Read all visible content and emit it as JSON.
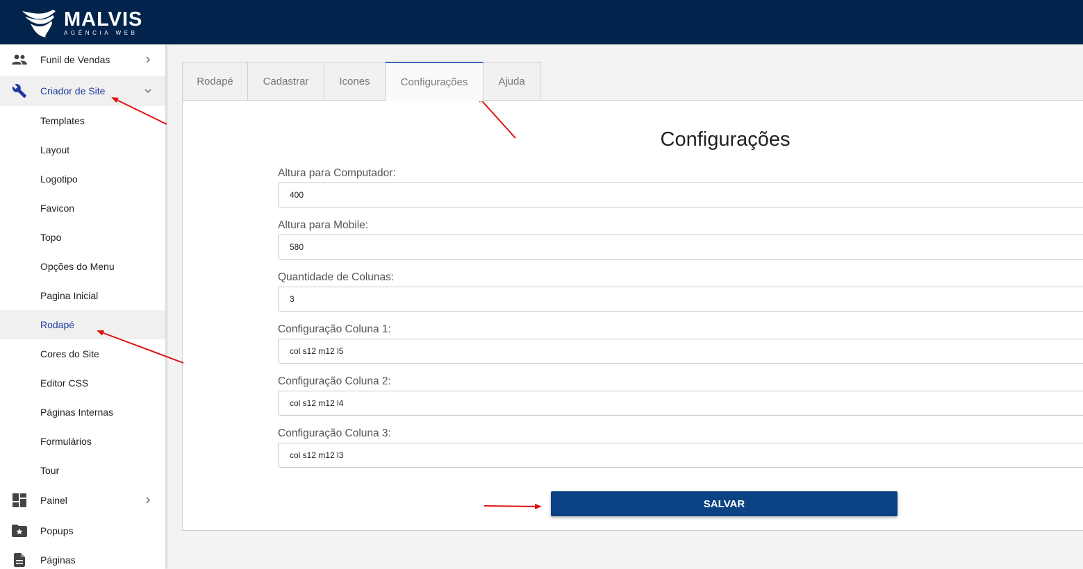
{
  "header": {
    "logo_text": "MALVIS",
    "logo_subtext": "AGÊNCIA WEB",
    "bg_color": "#02234b"
  },
  "sidebar": {
    "funil": {
      "label": "Funil de Vendas",
      "icon": "people-icon"
    },
    "criador": {
      "label": "Criador de Site",
      "icon": "wrench-icon"
    },
    "subitems": [
      "Templates",
      "Layout",
      "Logotipo",
      "Favicon",
      "Topo",
      "Opções do Menu",
      "Pagina Inicial",
      "Rodapé",
      "Cores do Site",
      "Editor CSS",
      "Páginas Internas",
      "Formulários",
      "Tour"
    ],
    "active_subitem": "Rodapé",
    "painel": {
      "label": "Painel",
      "icon": "dashboard-icon"
    },
    "popups": {
      "label": "Popups",
      "icon": "folder-star-icon"
    },
    "paginas": {
      "label": "Páginas",
      "icon": "document-icon"
    },
    "active_color": "#1f3aa0"
  },
  "tabs": [
    "Rodapé",
    "Cadastrar",
    "Icones",
    "Configurações",
    "Ajuda"
  ],
  "active_tab": "Configurações",
  "form": {
    "title": "Configurações",
    "fields": [
      {
        "label": "Altura para Computador:",
        "value": "400"
      },
      {
        "label": "Altura para Mobile:",
        "value": "580"
      },
      {
        "label": "Quantidade de Colunas:",
        "value": "3"
      },
      {
        "label": "Configuração Coluna 1:",
        "value": "col s12 m12 l5"
      },
      {
        "label": "Configuração Coluna 2:",
        "value": "col s12 m12 l4"
      },
      {
        "label": "Configuração Coluna 3:",
        "value": "col s12 m12 l3"
      }
    ],
    "save_label": "SALVAR",
    "button_color": "#0b4283"
  },
  "annotation_color": "#e01010"
}
